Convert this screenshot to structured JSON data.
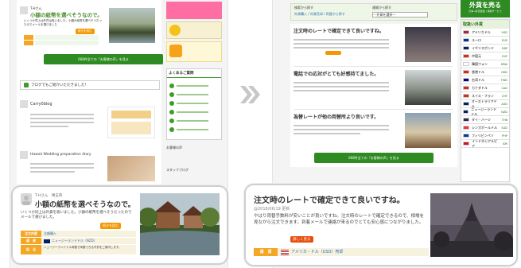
{
  "left_page": {
    "review1": {
      "user": "T-Hさん",
      "title": "小額の紙幣を選べそうなので。",
      "body": "いくつか同上は外貨は吸いました。小額の紙幣を選べそうだったのでメールを選びました",
      "more": "続きを読む"
    },
    "more_button": "668件全ての「お客様の声」を見る",
    "blog_banner": "ブログでもご紹介いただきました！",
    "blog1_title": "Carry0blog",
    "blog2_title": "Hawaii Wedding preparation diary",
    "sidebar_faq_title": "よくあるご質問",
    "sidebar_guide": "お客様の声",
    "sidebar_staff": "スタッフブログ"
  },
  "right_page": {
    "filter_label1": "検索から探す",
    "filter_label2": "通貨から探す",
    "filter_links": "外貨購入 / 外貨売却 / 両替から探す",
    "filter_select": "---外貨を選択---",
    "review1_title": "注文時のレートで確定できて良いですね。",
    "review2_title": "電話での応対がとても好感持てました。",
    "review3_title": "為替レートが他の両替所より良いです。",
    "more_button": "668件全ての「お客様の声」を見る",
    "sell_banner": "外貨を売る",
    "sell_sub": "日本→外貨送金 | 両替サービス",
    "rates_title": "取扱い外貨",
    "currencies": [
      {
        "name": "アメリカドル",
        "code": "USD",
        "color": "#b22234"
      },
      {
        "name": "ユーロ",
        "code": "EUR",
        "color": "#003399"
      },
      {
        "name": "イギリスポンド",
        "code": "GBP",
        "color": "#012169"
      },
      {
        "name": "中国元",
        "code": "CNY",
        "color": "#de2910"
      },
      {
        "name": "韓国ウォン",
        "code": "KRW",
        "color": "#ffffff"
      },
      {
        "name": "香港ドル",
        "code": "HKD",
        "color": "#de2910"
      },
      {
        "name": "台湾ドル",
        "code": "TWD",
        "color": "#000095"
      },
      {
        "name": "カナダドル",
        "code": "CAD",
        "color": "#d52b1e"
      },
      {
        "name": "スイス・フラン",
        "code": "CHF",
        "color": "#d52b1e"
      },
      {
        "name": "オーストラリアドル",
        "code": "AUD",
        "color": "#012169"
      },
      {
        "name": "ニュージーランドドル",
        "code": "NZD",
        "color": "#012169"
      },
      {
        "name": "タイ・バーツ",
        "code": "THB",
        "color": "#2d2a4a"
      },
      {
        "name": "シンガポールドル",
        "code": "SGD",
        "color": "#ef3340"
      },
      {
        "name": "フィリピンペソ",
        "code": "PHP",
        "color": "#0038a8"
      },
      {
        "name": "インドネシアルピア",
        "code": "IDR",
        "color": "#ce1126"
      }
    ]
  },
  "callout_left": {
    "user": "T-Hさん　埼玉県",
    "title": "小額の紙幣を選べそうなので。",
    "body": "いくつか同上は外貨を吸いました。小額の紙幣を選べそうだったのでメールで選びました。",
    "more": "続きを読む",
    "row1_label": "注文内容",
    "row1_value": "全額購入",
    "row2_label": "通　貨",
    "row2_value": "ニュージーランドドル（NZD）",
    "row3_label": "担　当",
    "row3_value": "ニュージーランドドル両替で両替できる外貨をご案内します。"
  },
  "callout_right": {
    "title": "注文時のレートで確定できて良いですね。",
    "date": "@2018/06/19 更新",
    "body": "やはり両替手数料が安いことが良いですね。注文時のレートで確定できるので、相場を見ながら注文できます。到着メールで連絡が来るのでとても安心感につながりました。",
    "more": "詳しく見る",
    "row_label": "通　貨",
    "row_value": "アメリカ・ドル（USD）売却"
  }
}
